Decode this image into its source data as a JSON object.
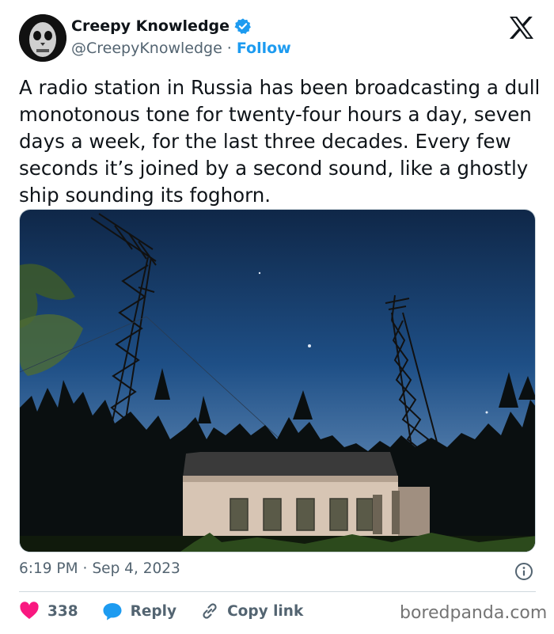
{
  "author": {
    "display_name": "Creepy Knowledge",
    "handle": "@CreepyKnowledge",
    "separator": "·",
    "follow_label": "Follow",
    "verified": true
  },
  "tweet": {
    "text": "A radio station in Russia has been broadcasting a dull monotonous tone for twenty-four hours a day, seven days a week, for the last three decades. Every few seconds it’s joined by a second sound, like a ghostly ship sounding its foghorn."
  },
  "meta": {
    "time": "6:19 PM",
    "separator": "·",
    "date": "Sep 4, 2023"
  },
  "actions": {
    "like_count": "338",
    "reply_label": "Reply",
    "copy_link_label": "Copy link"
  },
  "watermark": "boredpanda.com",
  "icons": {
    "x_logo": "x-logo-icon",
    "verified": "verified-badge-icon",
    "info": "info-icon",
    "like": "heart-icon",
    "reply": "chat-bubble-icon",
    "link": "link-icon"
  },
  "colors": {
    "accent": "#1d9bf0",
    "like": "#f91880",
    "text": "#0f1419",
    "muted": "#536471"
  }
}
